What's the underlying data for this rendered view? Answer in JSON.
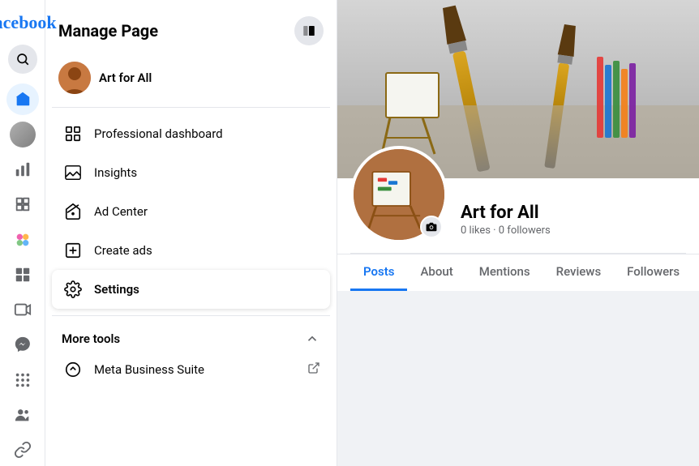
{
  "app": {
    "name": "facebook",
    "logo_text": "facebook"
  },
  "sidebar": {
    "title": "Manage Page",
    "page": {
      "name": "Art for All"
    },
    "menu_items": [
      {
        "id": "professional-dashboard",
        "label": "Professional dashboard",
        "icon": "chart-bar"
      },
      {
        "id": "insights",
        "label": "Insights",
        "icon": "insights"
      },
      {
        "id": "ad-center",
        "label": "Ad Center",
        "icon": "megaphone"
      },
      {
        "id": "create-ads",
        "label": "Create ads",
        "icon": "pencil-square"
      },
      {
        "id": "settings",
        "label": "Settings",
        "icon": "gear",
        "active": true
      }
    ],
    "more_tools": {
      "label": "More tools",
      "items": [
        {
          "id": "meta-business-suite",
          "label": "Meta Business Suite",
          "icon": "external-link"
        }
      ]
    }
  },
  "profile": {
    "name": "Art for All",
    "likes": "0 likes",
    "followers": "0 followers",
    "stats": "0 likes · 0 followers"
  },
  "tabs": [
    {
      "id": "posts",
      "label": "Posts",
      "active": true
    },
    {
      "id": "about",
      "label": "About"
    },
    {
      "id": "mentions",
      "label": "Mentions"
    },
    {
      "id": "reviews",
      "label": "Reviews"
    },
    {
      "id": "followers",
      "label": "Followers"
    }
  ],
  "nav_icons": [
    {
      "id": "home",
      "icon": "home"
    },
    {
      "id": "avatar",
      "icon": "avatar"
    },
    {
      "id": "chart",
      "icon": "chart"
    },
    {
      "id": "puzzle",
      "icon": "puzzle"
    },
    {
      "id": "color",
      "icon": "color"
    },
    {
      "id": "grid-bar",
      "icon": "grid-bar"
    },
    {
      "id": "play",
      "icon": "play"
    },
    {
      "id": "face",
      "icon": "face"
    },
    {
      "id": "grid",
      "icon": "grid"
    },
    {
      "id": "people",
      "icon": "people"
    },
    {
      "id": "link",
      "icon": "link"
    }
  ]
}
